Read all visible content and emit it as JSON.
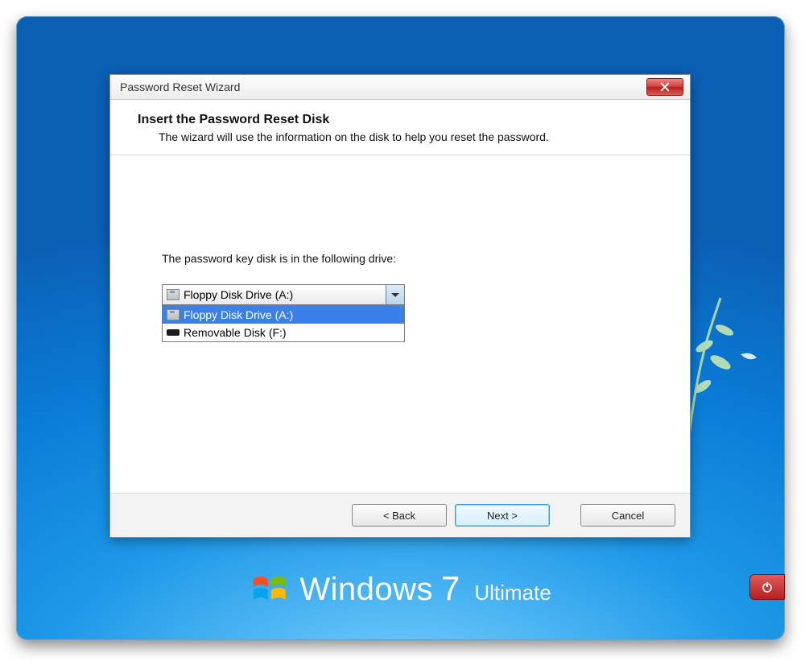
{
  "titlebar": {
    "title": "Password Reset Wizard"
  },
  "header": {
    "line1": "Insert the Password Reset Disk",
    "line2": "The wizard will use the information on the disk to help you reset the password."
  },
  "body": {
    "label": "The password key disk is in the following drive:"
  },
  "combo": {
    "selected_label": "Floppy Disk Drive (A:)",
    "options": [
      {
        "label": "Floppy Disk Drive (A:)",
        "icon": "floppy",
        "selected": true
      },
      {
        "label": "Removable Disk (F:)",
        "icon": "usb",
        "selected": false
      }
    ]
  },
  "buttons": {
    "back": "< Back",
    "next": "Next >",
    "cancel": "Cancel"
  },
  "brand": {
    "name": "Windows",
    "version": "7",
    "edition": "Ultimate"
  }
}
